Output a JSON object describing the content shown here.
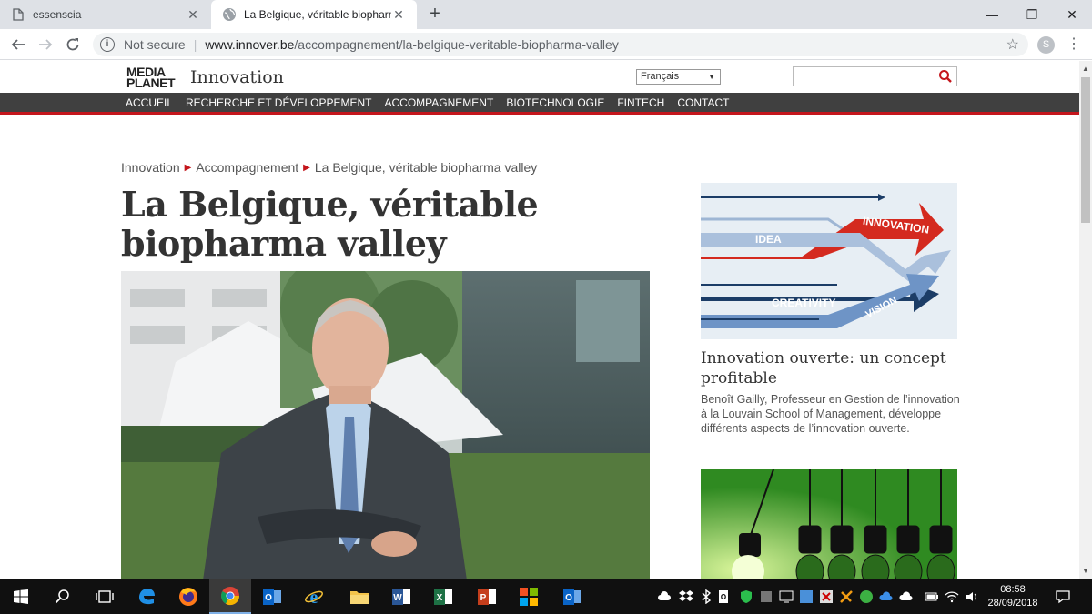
{
  "browser": {
    "tabs": [
      {
        "title": "essenscia",
        "active": false
      },
      {
        "title": "La Belgique, véritable biopharma",
        "active": true
      }
    ],
    "new_tab": "+",
    "window_controls": {
      "minimize": "—",
      "restore": "❐",
      "close": "✕"
    },
    "security_label": "Not secure",
    "url_host": "www.innover.be",
    "url_path": "/accompagnement/la-belgique-veritable-biopharma-valley",
    "profile_initial": "S"
  },
  "site": {
    "logo_line1": "MEDIA",
    "logo_line2": "PLANET",
    "logo_subtitle": "Innovation",
    "language": "Français",
    "search_placeholder": "",
    "nav": [
      "ACCUEIL",
      "RECHERCHE ET DÉVELOPPEMENT",
      "ACCOMPAGNEMENT",
      "BIOTECHNOLOGIE",
      "FINTECH",
      "CONTACT"
    ]
  },
  "article": {
    "breadcrumb": [
      "Innovation",
      "Accompagnement",
      "La Belgique, véritable biopharma valley"
    ],
    "title_line1": "La Belgique, véritable",
    "title_line2": "biopharma valley"
  },
  "sidebar": {
    "card1": {
      "image_labels": [
        "INNOVATION",
        "IDEA",
        "CREATIVITY",
        "VISION"
      ],
      "title": "Innovation ouverte: un concept profitable",
      "text": "Benoît Gailly, Professeur en Gestion de l’innovation à la Louvain School of Management, développe différents aspects de l’innovation ouverte."
    }
  },
  "taskbar": {
    "time": "08:58",
    "date": "28/09/2018"
  },
  "colors": {
    "accent_red": "#c4161c",
    "nav_bg": "#404040",
    "taskbar_bg": "#101010"
  }
}
